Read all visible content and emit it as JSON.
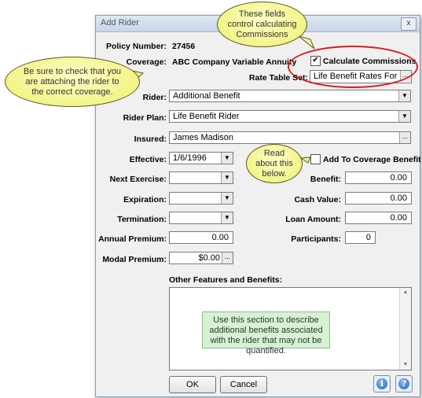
{
  "window": {
    "title": "Add Rider",
    "close_glyph": "x"
  },
  "policy": {
    "label": "Policy Number:",
    "value": "27456"
  },
  "coverage": {
    "label": "Coverage:",
    "value": "ABC Company Variable Annuity"
  },
  "calc_commissions": {
    "label": "Calculate Commissions",
    "checked": true
  },
  "rate_table": {
    "label": "Rate Table Set:",
    "value": "Life Benefit Rates For"
  },
  "rider": {
    "label": "Rider:",
    "value": "Additional Benefit"
  },
  "rider_plan": {
    "label": "Rider Plan:",
    "value": "Life Benefit Rider"
  },
  "insured": {
    "label": "Insured:",
    "value": "James Madison"
  },
  "effective": {
    "label": "Effective:",
    "value": "1/6/1996"
  },
  "add_to_coverage": {
    "label": "Add To Coverage Benefit",
    "checked": false
  },
  "next_exercise": {
    "label": "Next Exercise:",
    "value": ""
  },
  "benefit": {
    "label": "Benefit:",
    "value": "0.00"
  },
  "expiration": {
    "label": "Expiration:",
    "value": ""
  },
  "cash_value": {
    "label": "Cash Value:",
    "value": "0.00"
  },
  "termination": {
    "label": "Termination:",
    "value": ""
  },
  "loan_amount": {
    "label": "Loan Amount:",
    "value": "0.00"
  },
  "annual_premium": {
    "label": "Annual Premium:",
    "value": "0.00"
  },
  "participants": {
    "label": "Participants:",
    "value": "0"
  },
  "modal_premium": {
    "label": "Modal Premium:",
    "value": "$0.00"
  },
  "other_features": {
    "label": "Other Features and Benefits:",
    "value": ""
  },
  "buttons": {
    "ok": "OK",
    "cancel": "Cancel",
    "info_glyph": "i",
    "help_glyph": "?"
  },
  "glyphs": {
    "dropdown": "▼",
    "ellipsis": "...",
    "check": "✔",
    "scroll_up": "▲",
    "scroll_down": "▼"
  },
  "callouts": {
    "commissions": "These fields control calculating Commissions",
    "coverage_check": "Be sure to check that you are attaching the rider to the correct coverage.",
    "read_about": "Read about this below.",
    "features_note": "Use this section to describe additional benefits associated with the rider that may not be quantified."
  },
  "colors": {
    "callout_yellow": "#eef070",
    "note_green": "#d5f2d2",
    "highlight_red": "#d62020"
  }
}
